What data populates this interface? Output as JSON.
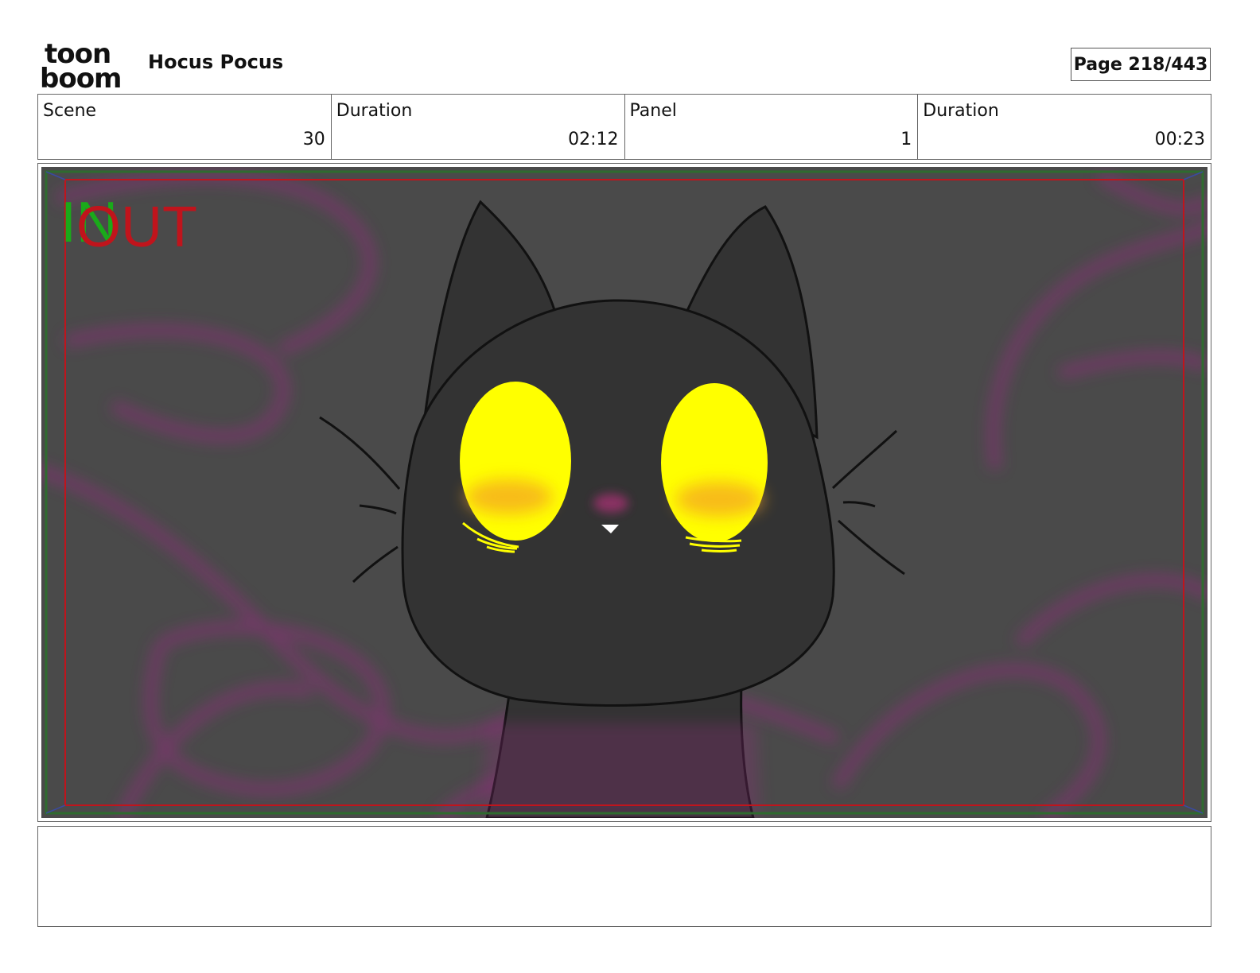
{
  "header": {
    "logo_text_top": "toon",
    "logo_text_bottom": "boom",
    "project_title": "Hocus Pocus",
    "page_indicator": "Page 218/443"
  },
  "info": [
    {
      "label": "Scene",
      "value": "30"
    },
    {
      "label": "Duration",
      "value": "02:12"
    },
    {
      "label": "Panel",
      "value": "1"
    },
    {
      "label": "Duration",
      "value": "00:23"
    }
  ],
  "panel": {
    "markers": {
      "in_label": "IN",
      "out_label": "OUT"
    },
    "colors": {
      "background": "#4a4a4a",
      "cat_body": "#333333",
      "eyes": "#ffff00",
      "eye_glow": "#f5a623",
      "magic_swirl": "#8e2f7a",
      "safe_frame": "#c0141c",
      "outer_frame": "#2f6b2f",
      "in_marker": "#1aaa1a",
      "out_marker": "#c0141c"
    }
  },
  "notes": {
    "text": ""
  }
}
